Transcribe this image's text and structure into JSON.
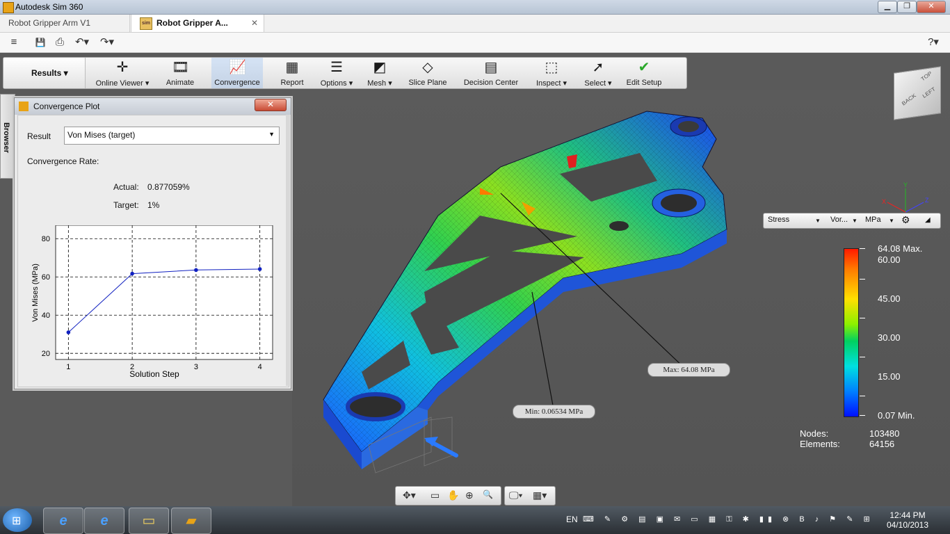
{
  "window": {
    "title": "Autodesk Sim 360",
    "min": "▁",
    "max": "❐",
    "close": "✕"
  },
  "tabs": [
    {
      "label": "Robot Gripper Arm V1"
    },
    {
      "label": "Robot Gripper A...",
      "close": "✕",
      "icon_text": "sim"
    }
  ],
  "qat": {
    "menu": "≡",
    "save": "💾",
    "export": "⎙",
    "undo": "↶▾",
    "redo": "↷▾",
    "help": "?▾"
  },
  "ribbon": {
    "results_label": "Results ▾",
    "buttons": [
      {
        "label": "Online Viewer ▾",
        "icon": "✛"
      },
      {
        "label": "Animate",
        "icon": "🎞"
      },
      {
        "label": "Convergence",
        "icon": "📈"
      },
      {
        "label": "Report",
        "icon": "▦"
      },
      {
        "label": "Options ▾",
        "icon": "☰"
      },
      {
        "label": "Mesh ▾",
        "icon": "◩"
      },
      {
        "label": "Slice Plane",
        "icon": "◇"
      },
      {
        "label": "Decision Center",
        "icon": "▤"
      },
      {
        "label": "Inspect ▾",
        "icon": "⬚"
      },
      {
        "label": "Select ▾",
        "icon": "➚"
      },
      {
        "label": "Edit Setup",
        "icon": "✔"
      }
    ]
  },
  "browser_tab": "Browser",
  "dialog": {
    "title": "Convergence Plot",
    "close": "✕",
    "result_label": "Result",
    "result_value": "Von Mises (target)",
    "dropdown_arrow": "▼",
    "convergence_rate_label": "Convergence Rate:",
    "actual_label": "Actual:",
    "actual_value": "0.877059%",
    "target_label": "Target:",
    "target_value": "1%"
  },
  "chart_data": {
    "type": "line",
    "x": [
      1,
      2,
      3,
      4
    ],
    "values": [
      31.0,
      61.7,
      63.6,
      64.1
    ],
    "xlabel": "Solution Step",
    "ylabel": "Von Mises (MPa)",
    "yticks": [
      "20",
      "40",
      "60",
      "80"
    ],
    "xticks": [
      "1",
      "2",
      "3",
      "4"
    ],
    "ylim": [
      16.8,
      87
    ],
    "xlim": [
      0.8,
      4.2
    ],
    "grid": true,
    "color": "#1020c0"
  },
  "viewcube": {
    "back": "BACK",
    "left": "LEFT",
    "top": "TOP"
  },
  "results_bar": {
    "result_type": "Stress",
    "component": "Vor...",
    "unit": "MPa",
    "gear": "⚙",
    "collapse": "◢"
  },
  "legend": {
    "max_label": "64.08 Max.",
    "min_label": "0.07 Min.",
    "ticks": [
      "60.00",
      "45.00",
      "30.00",
      "15.00"
    ]
  },
  "stats": {
    "nodes_label": "Nodes:",
    "nodes_value": "103480",
    "elements_label": "Elements:",
    "elements_value": "64156"
  },
  "callouts": {
    "max": "Max: 64.08 MPa",
    "min": "Min: 0.06534 MPa"
  },
  "navbar": {
    "orbit": "✥▾",
    "view": "▭",
    "pan": "✋",
    "zoom": "⊕",
    "zoom_window": "🔍",
    "display": "🖵▾",
    "grid": "▦▾"
  },
  "taskbar": {
    "start": "⊞",
    "apps": [
      {
        "icon": "e"
      },
      {
        "icon": "e"
      },
      {
        "icon": "▭"
      },
      {
        "icon": "▰"
      }
    ],
    "lang": "EN",
    "tray_icons": "⌨ ✎ ⚙ ▤ ▣ ✉ ▭ ▦ ⚿ ✱ ▮▮ ⊗ B ♪ ⚑ ✎ ⊞",
    "time": "12:44 PM",
    "date": "04/10/2013"
  }
}
